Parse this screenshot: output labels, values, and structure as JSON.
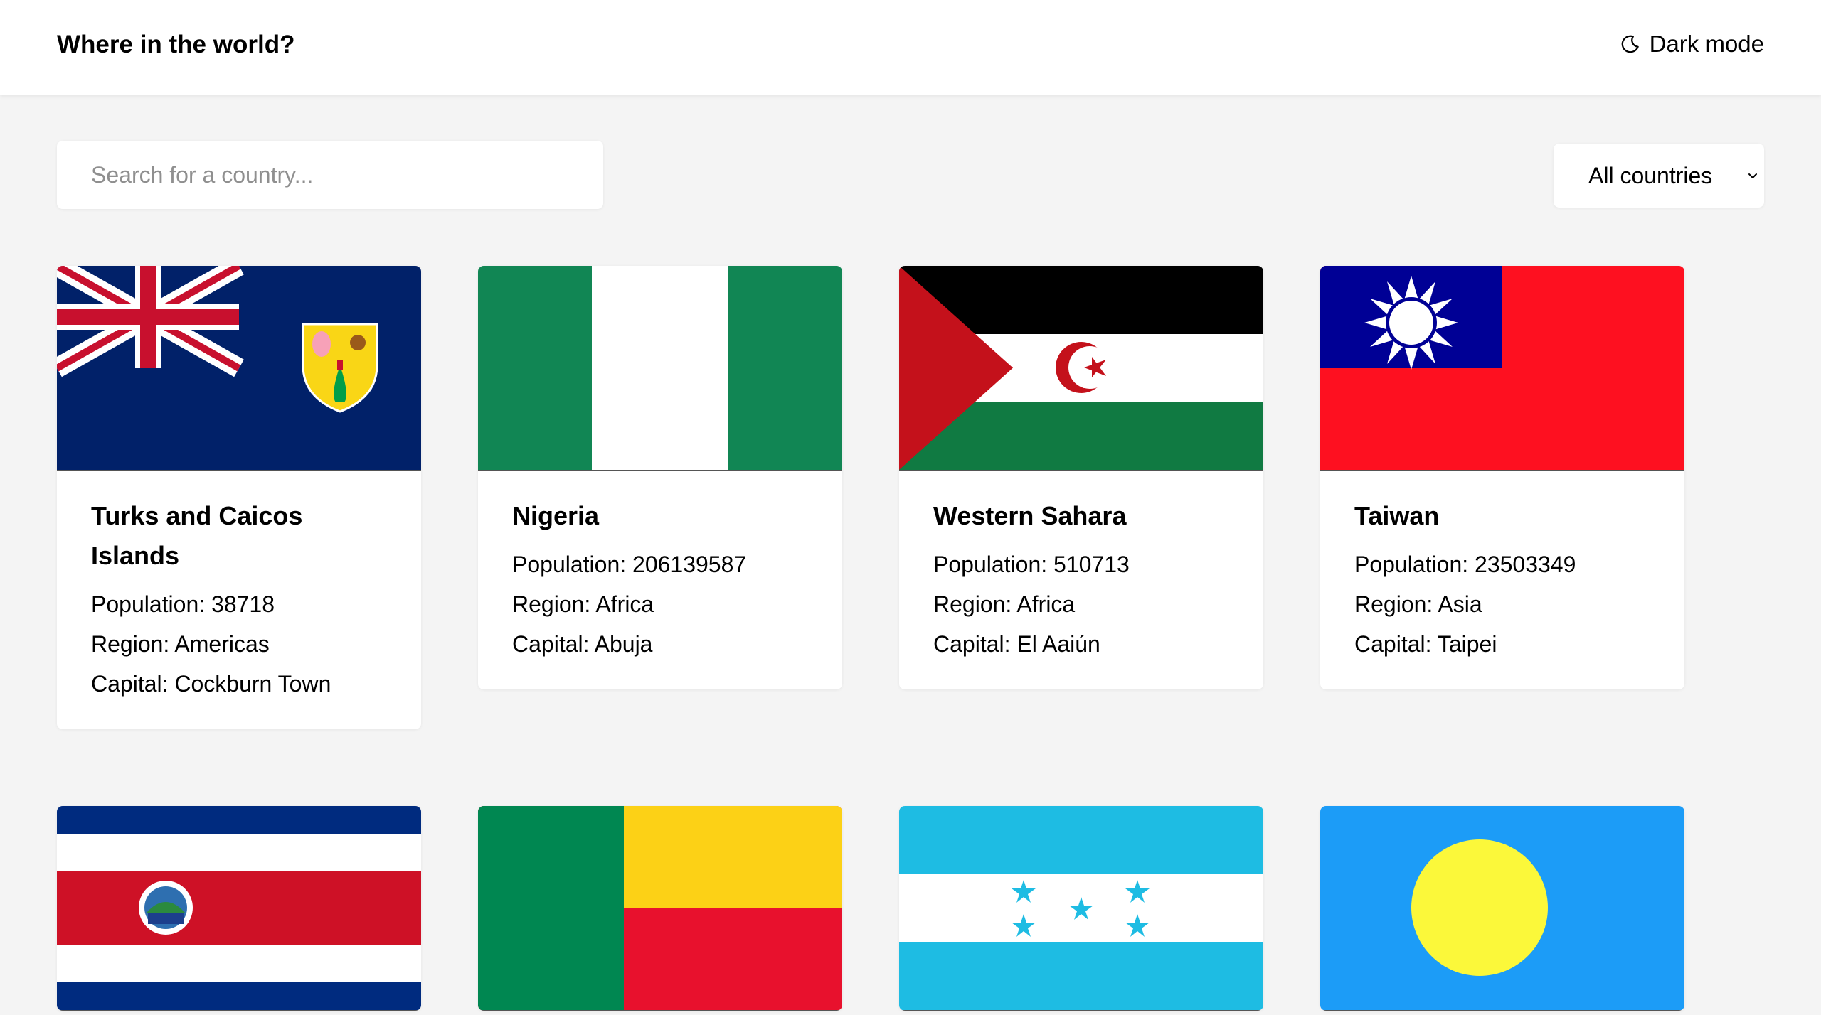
{
  "header": {
    "title": "Where in the world?",
    "dark_mode_label": "Dark mode"
  },
  "search": {
    "placeholder": "Search for a country...",
    "value": ""
  },
  "filter": {
    "selected": "All countries"
  },
  "countries": [
    {
      "name": "Turks and Caicos Islands",
      "population": "Population: 38718",
      "region": "Region: Americas",
      "capital": "Capital: Cockburn Town",
      "flag": "turks-and-caicos-flag"
    },
    {
      "name": "Nigeria",
      "population": "Population: 206139587",
      "region": "Region: Africa",
      "capital": "Capital: Abuja",
      "flag": "nigeria-flag"
    },
    {
      "name": "Western Sahara",
      "population": "Population: 510713",
      "region": "Region: Africa",
      "capital": "Capital: El Aaiún",
      "flag": "western-sahara-flag"
    },
    {
      "name": "Taiwan",
      "population": "Population: 23503349",
      "region": "Region: Asia",
      "capital": "Capital: Taipei",
      "flag": "taiwan-flag"
    },
    {
      "flag": "costa-rica-flag"
    },
    {
      "flag": "benin-flag"
    },
    {
      "flag": "honduras-flag"
    },
    {
      "flag": "palau-flag"
    }
  ],
  "colors": {
    "page_background": "#f4f4f4",
    "card_background": "#ffffff",
    "placeholder_text": "#8f8f8f"
  }
}
